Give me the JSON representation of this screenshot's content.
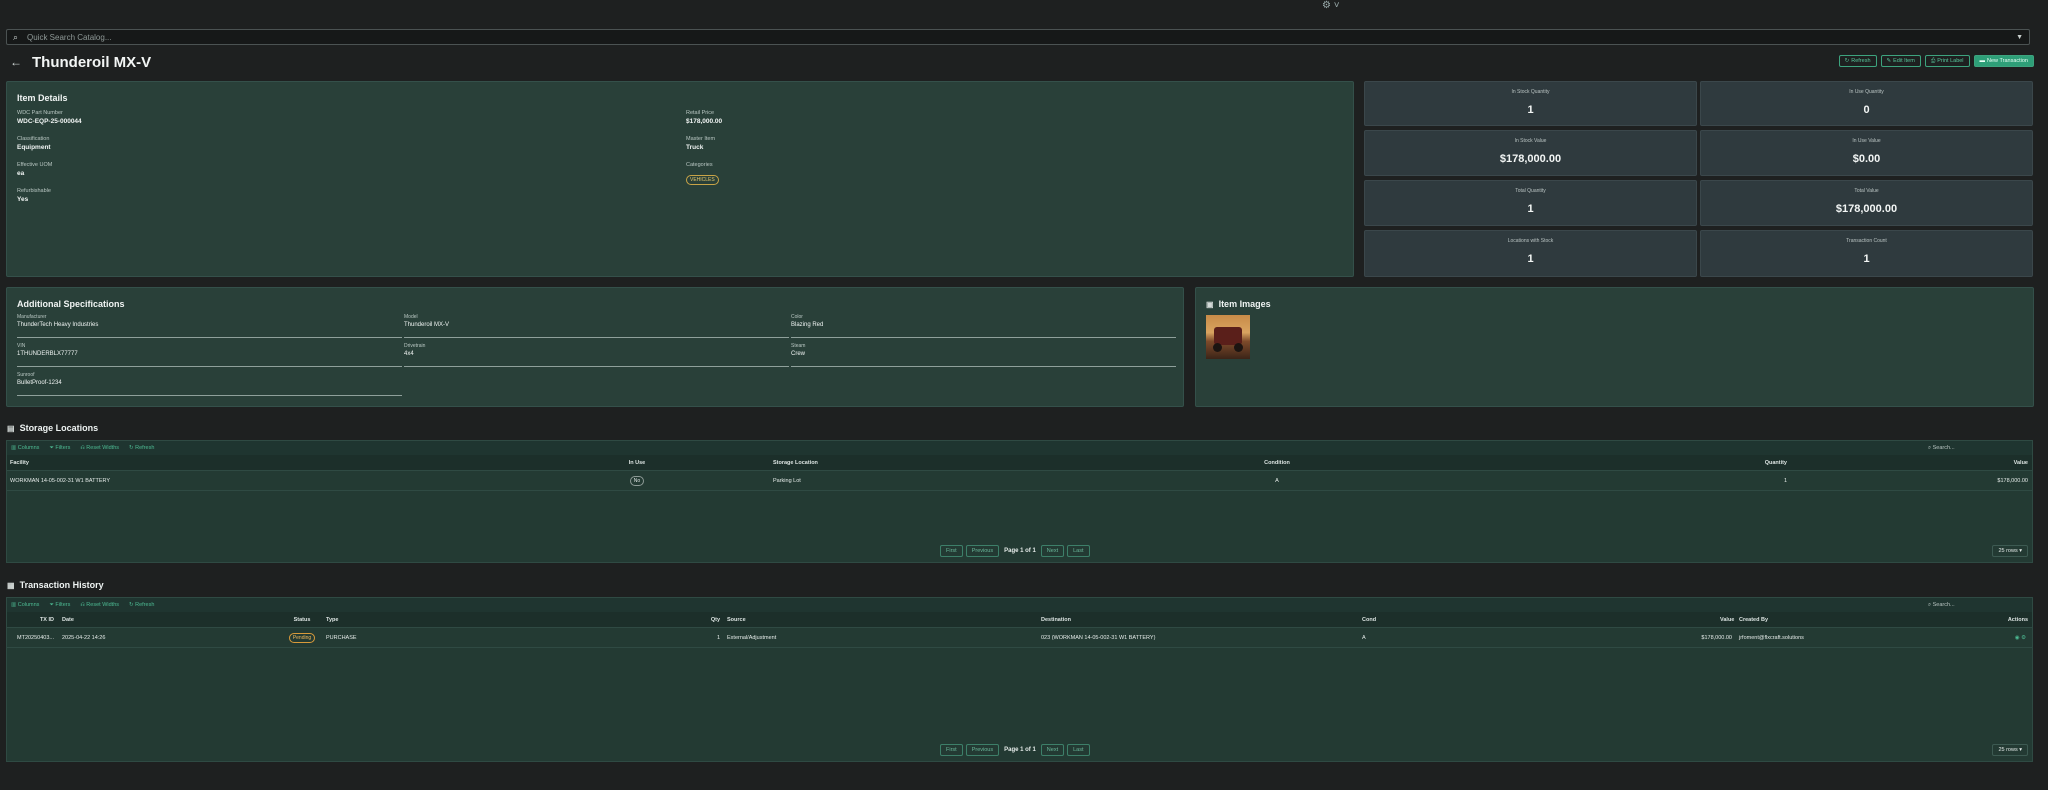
{
  "search": {
    "placeholder": "Quick Search Catalog..."
  },
  "header": {
    "title": "Thunderoil MX-V",
    "buttons": [
      "Refresh",
      "Edit Item",
      "Print Label",
      "New Transaction"
    ]
  },
  "item_details": {
    "heading": "Item Details",
    "left": [
      {
        "label": "WDC Part Number",
        "value": "WDC-EQP-25-000044"
      },
      {
        "label": "Classification",
        "value": "Equipment"
      },
      {
        "label": "Effective UOM",
        "value": "ea"
      },
      {
        "label": "Refurbishable",
        "value": "Yes"
      }
    ],
    "right": [
      {
        "label": "Retail Price",
        "value": "$178,000.00"
      },
      {
        "label": "Master Item",
        "value": "Truck"
      },
      {
        "label": "Categories",
        "tag": "VEHICLES"
      }
    ]
  },
  "stats": [
    {
      "label": "In Stock Quantity",
      "value": "1"
    },
    {
      "label": "In Use Quantity",
      "value": "0"
    },
    {
      "label": "In Stock Value",
      "value": "$178,000.00"
    },
    {
      "label": "In Use Value",
      "value": "$0.00"
    },
    {
      "label": "Total Quantity",
      "value": "1"
    },
    {
      "label": "Total Value",
      "value": "$178,000.00"
    },
    {
      "label": "Locations with Stock",
      "value": "1"
    },
    {
      "label": "Transaction Count",
      "value": "1"
    }
  ],
  "specs": {
    "heading": "Additional Specifications",
    "fields": [
      {
        "label": "Manufacturer",
        "value": "ThunderTech Heavy Industries"
      },
      {
        "label": "Model",
        "value": "Thunderoil MX-V"
      },
      {
        "label": "Color",
        "value": "Blazing Red"
      },
      {
        "label": "VIN",
        "value": "1THUNDERBLX77777"
      },
      {
        "label": "Drivetrain",
        "value": "4x4"
      },
      {
        "label": "Steam",
        "value": "Crew"
      },
      {
        "label": "Sunroof",
        "value": "BulletProof-1234"
      }
    ]
  },
  "images": {
    "heading": "Item Images"
  },
  "storage": {
    "heading": "Storage Locations",
    "toolbar": [
      "Columns",
      "Filters",
      "Reset Widths",
      "Refresh"
    ],
    "search_placeholder": "Search...",
    "columns": [
      "Facility",
      "In Use",
      "Storage Location",
      "Condition",
      "Quantity",
      "Value"
    ],
    "rows": [
      {
        "facility": "WORKMAN 14-05-002-31 W1 BATTERY",
        "in_use": "No",
        "location": "Parking Lot",
        "condition": "A",
        "quantity": "1",
        "value": "$178,000.00"
      }
    ],
    "pager": {
      "first": "First",
      "prev": "Previous",
      "info": "Page 1 of 1",
      "next": "Next",
      "last": "Last",
      "rows": "25 rows"
    }
  },
  "transactions": {
    "heading": "Transaction History",
    "toolbar": [
      "Columns",
      "Filters",
      "Reset Widths",
      "Refresh"
    ],
    "search_placeholder": "Search...",
    "columns": [
      "TX ID",
      "Date",
      "Status",
      "Type",
      "Qty",
      "Source",
      "Destination",
      "Cond",
      "Value",
      "Created By",
      "Actions"
    ],
    "rows": [
      {
        "tx": "MT20250403...",
        "date": "2025-04-22 14:26",
        "status": "Pending",
        "type": "PURCHASE",
        "qty": "1",
        "source": "External/Adjustment",
        "dest": "023 (WORKMAN 14-05-002-31 W1 BATTERY)",
        "cond": "A",
        "value": "$178,000.00",
        "created": "jrfoment@flxcraft.solutions"
      }
    ],
    "pager": {
      "first": "First",
      "prev": "Previous",
      "info": "Page 1 of 1",
      "next": "Next",
      "last": "Last",
      "rows": "25 rows"
    }
  }
}
